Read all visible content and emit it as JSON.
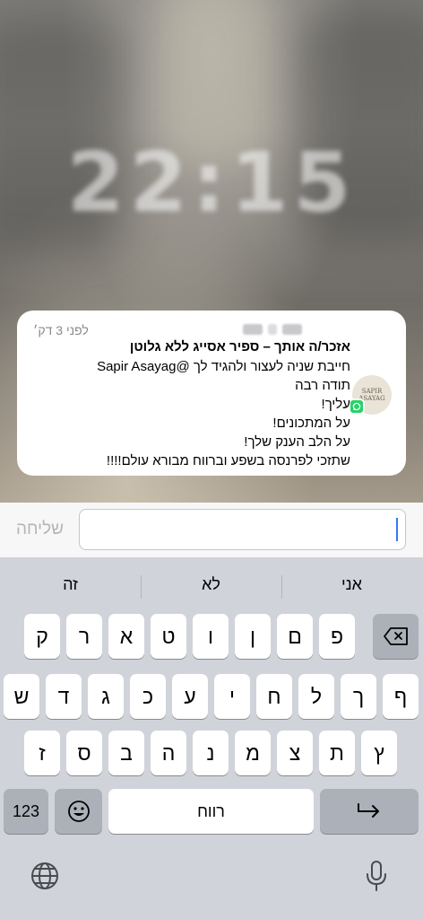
{
  "lock_screen": {
    "clock": "22:15"
  },
  "notification": {
    "app_icon": "whatsapp-icon",
    "avatar_text": "SAPIR ASAYAG",
    "time": "לפני 3 דק׳",
    "title": "אזכר/ה אותך – ספיר אסייג ללא גלוטן",
    "lines": [
      "חייבת שניה לעצור ולהגיד לך @Sapir Asayag",
      "תודה רבה",
      "עליך!",
      "על המתכונים!",
      "על הלב הענק שלך!",
      "שתזכי לפרנסה בשפע וברווח מבורא עולם!!!!"
    ]
  },
  "reply": {
    "send_label": "שליחה",
    "input_value": ""
  },
  "keyboard": {
    "suggestions": [
      "אני",
      "לא",
      "זה"
    ],
    "row1": [
      "פ",
      "ם",
      "ן",
      "ו",
      "ט",
      "א",
      "ר",
      "ק"
    ],
    "row2": [
      "ף",
      "ך",
      "ל",
      "ח",
      "י",
      "ע",
      "כ",
      "ג",
      "ד",
      "ש"
    ],
    "row3": [
      "ץ",
      "ת",
      "צ",
      "מ",
      "נ",
      "ה",
      "ב",
      "ס",
      "ז"
    ],
    "numbers_label": "123",
    "space_label": "רווח",
    "icons": {
      "delete": "delete-icon",
      "emoji": "emoji-icon",
      "return": "return-icon",
      "globe": "globe-icon",
      "mic": "microphone-icon"
    },
    "accent_color": "#3478f6"
  }
}
